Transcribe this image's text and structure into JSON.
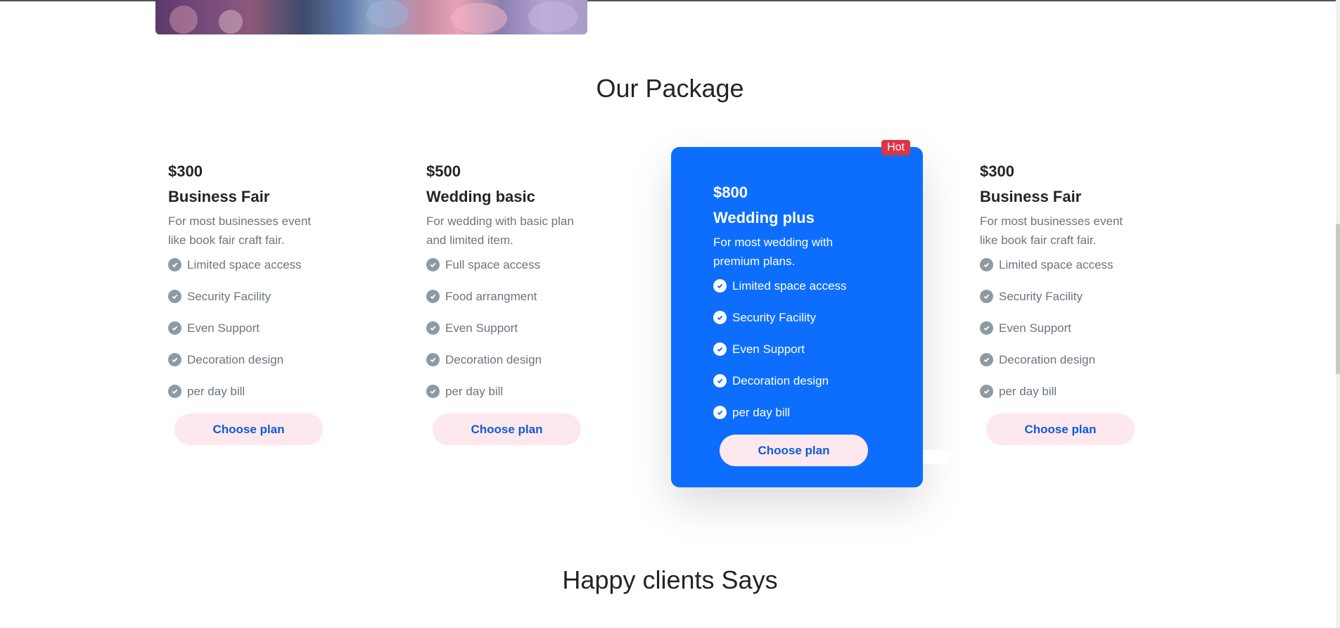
{
  "section_title": "Our Package",
  "next_section_title": "Happy clients Says",
  "packages": [
    {
      "price": "$300",
      "name": "Business Fair",
      "description": "For most businesses event like book fair craft fair.",
      "features": [
        "Limited space access",
        "Security Facility",
        "Even Support",
        "Decoration design",
        "per day bill"
      ],
      "button_label": "Choose plan"
    },
    {
      "price": "$500",
      "name": "Wedding basic",
      "description": "For wedding with basic plan and limited item.",
      "features": [
        "Full space access",
        "Food arrangment",
        "Even Support",
        "Decoration design",
        "per day bill"
      ],
      "button_label": "Choose plan"
    },
    {
      "price": "$800",
      "name": "Wedding plus",
      "description": "For most wedding with premium plans.",
      "features": [
        "Limited space access",
        "Security Facility",
        "Even Support",
        "Decoration design",
        "per day bill"
      ],
      "button_label": "Choose plan",
      "badge": "Hot",
      "featured": true
    },
    {
      "price": "$300",
      "name": "Business Fair",
      "description": "For most businesses event like book fair craft fair.",
      "features": [
        "Limited space access",
        "Security Facility",
        "Even Support",
        "Decoration design",
        "per day bill"
      ],
      "button_label": "Choose plan"
    }
  ],
  "colors": {
    "featured_bg": "#0d6efd",
    "badge_bg": "#dc3545",
    "button_bg": "#fde8ee",
    "button_text": "#0d5bd6",
    "muted_text": "#6c757d",
    "check_icon": "#8e9aa3"
  },
  "icons": {
    "feature_bullet": "check-circle-icon"
  }
}
